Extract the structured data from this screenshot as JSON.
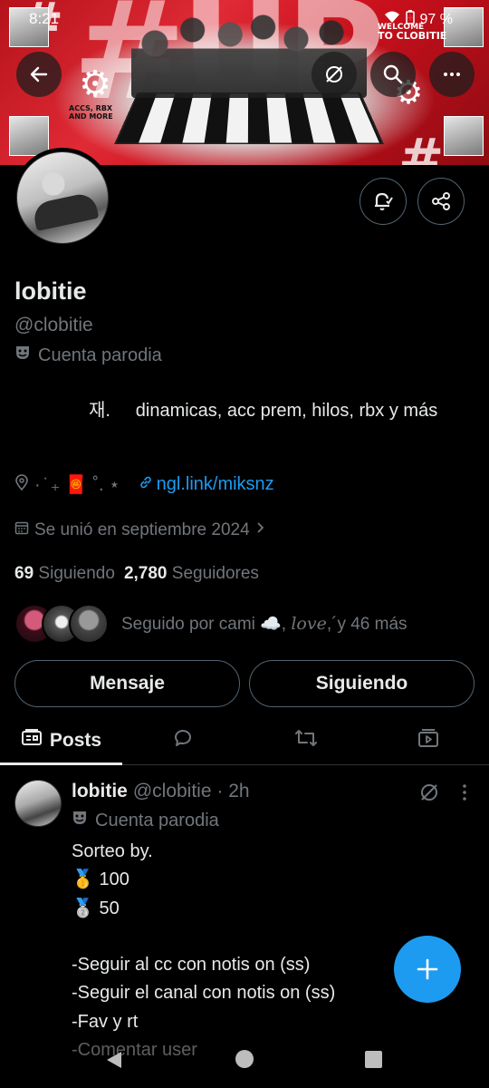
{
  "status_bar": {
    "time": "8:21",
    "battery": "97 %"
  },
  "banner": {
    "acc_lines": [
      "ACCS, RBX",
      "AND MORE"
    ],
    "welcome_lines": [
      "WELCOME",
      "TO CLOBITIE"
    ]
  },
  "profile": {
    "display_name": "lobitie",
    "handle": "@clobitie",
    "parody_label": "Cuenta parodia",
    "bio_prefix": "재.",
    "bio_text": "dinamicas, acc prem, hilos, rbx y más",
    "location": "· ̇ ₊ 🧧 ˚. ⋆",
    "link": "ngl.link/miksnz",
    "joined": "Se unió en septiembre 2024",
    "following_count": "69",
    "following_label": "Siguiendo",
    "followers_count": "2,780",
    "followers_label": "Seguidores",
    "followed_by_prefix": "Seguido por cami ☁️, ",
    "followed_by_italic": "love",
    "followed_by_suffix": ",´y 46 más"
  },
  "buttons": {
    "message": "Mensaje",
    "following": "Siguiendo"
  },
  "tabs": {
    "posts": "Posts"
  },
  "post": {
    "name": "lobitie",
    "handle_time": "@clobitie · 2h",
    "parody_label": "Cuenta parodia",
    "body": "Sorteo by.\n🥇 100\n🥈 50\n\n-Seguir al cc con notis on (ss)\n-Seguir el canal con notis on (ss)\n-Fav y rt\n-Comentar user"
  },
  "colors": {
    "accent": "#1d9bf0",
    "background": "#000000",
    "secondary_text": "#71767b",
    "border": "#2f3336"
  }
}
